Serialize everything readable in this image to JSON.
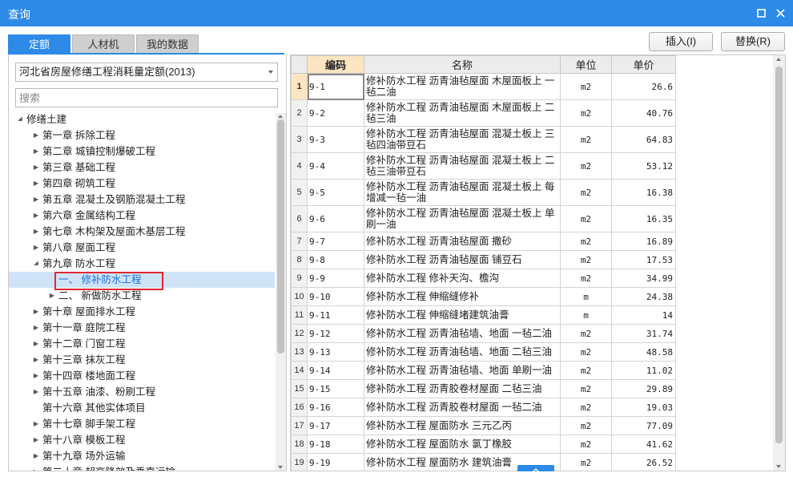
{
  "window": {
    "title": "查询"
  },
  "tabs": [
    {
      "label": "定额",
      "active": true
    },
    {
      "label": "人材机",
      "active": false
    },
    {
      "label": "我的数据",
      "active": false
    }
  ],
  "actions": {
    "insert_label": "插入(I)",
    "replace_label": "替换(R)"
  },
  "left": {
    "library_select": "河北省房屋修缮工程消耗量定额(2013)",
    "search_placeholder": "搜索",
    "tree": [
      {
        "label": "修缮土建",
        "level": 0,
        "state": "expanded"
      },
      {
        "label": "第一章 拆除工程",
        "level": 1,
        "state": "collapsed"
      },
      {
        "label": "第二章 城镇控制爆破工程",
        "level": 1,
        "state": "collapsed"
      },
      {
        "label": "第三章 基础工程",
        "level": 1,
        "state": "collapsed"
      },
      {
        "label": "第四章 砌筑工程",
        "level": 1,
        "state": "collapsed"
      },
      {
        "label": "第五章 混凝土及钢筋混凝土工程",
        "level": 1,
        "state": "collapsed"
      },
      {
        "label": "第六章 金属结构工程",
        "level": 1,
        "state": "collapsed"
      },
      {
        "label": "第七章 木构架及屋面木基层工程",
        "level": 1,
        "state": "collapsed"
      },
      {
        "label": "第八章 屋面工程",
        "level": 1,
        "state": "collapsed"
      },
      {
        "label": "第九章 防水工程",
        "level": 1,
        "state": "expanded"
      },
      {
        "label": "一、 修补防水工程",
        "level": 2,
        "state": "leaf",
        "selected": true
      },
      {
        "label": "二、 新做防水工程",
        "level": 2,
        "state": "collapsed"
      },
      {
        "label": "第十章 屋面排水工程",
        "level": 1,
        "state": "collapsed"
      },
      {
        "label": "第十一章 庭院工程",
        "level": 1,
        "state": "collapsed"
      },
      {
        "label": "第十二章 门窗工程",
        "level": 1,
        "state": "collapsed"
      },
      {
        "label": "第十三章 抹灰工程",
        "level": 1,
        "state": "collapsed"
      },
      {
        "label": "第十四章 楼地面工程",
        "level": 1,
        "state": "collapsed"
      },
      {
        "label": "第十五章 油漆、粉刷工程",
        "level": 1,
        "state": "collapsed"
      },
      {
        "label": "第十六章 其他实体项目",
        "level": 1,
        "state": "leaf"
      },
      {
        "label": "第十七章 脚手架工程",
        "level": 1,
        "state": "collapsed"
      },
      {
        "label": "第十八章 模板工程",
        "level": 1,
        "state": "collapsed"
      },
      {
        "label": "第十九章 场外运输",
        "level": 1,
        "state": "collapsed"
      },
      {
        "label": "第二十章 超高降效及垂直运输",
        "level": 1,
        "state": "collapsed"
      }
    ]
  },
  "grid": {
    "columns": {
      "code": "编码",
      "name": "名称",
      "unit": "单位",
      "price": "单价"
    },
    "rows": [
      {
        "n": "1",
        "code": "9-1",
        "name": "修补防水工程 沥青油毡屋面 木屋面板上 一毡二油",
        "unit": "m2",
        "price": "26.6"
      },
      {
        "n": "2",
        "code": "9-2",
        "name": "修补防水工程 沥青油毡屋面 木屋面板上 二毡三油",
        "unit": "m2",
        "price": "40.76"
      },
      {
        "n": "3",
        "code": "9-3",
        "name": "修补防水工程 沥青油毡屋面 混凝土板上 三毡四油带豆石",
        "unit": "m2",
        "price": "64.83"
      },
      {
        "n": "4",
        "code": "9-4",
        "name": "修补防水工程 沥青油毡屋面 混凝土板上 二毡三油带豆石",
        "unit": "m2",
        "price": "53.12"
      },
      {
        "n": "5",
        "code": "9-5",
        "name": "修补防水工程 沥青油毡屋面 混凝土板上 每增减一毡一油",
        "unit": "m2",
        "price": "16.38"
      },
      {
        "n": "6",
        "code": "9-6",
        "name": "修补防水工程 沥青油毡屋面 混凝土板上 单刷一油",
        "unit": "m2",
        "price": "16.35"
      },
      {
        "n": "7",
        "code": "9-7",
        "name": "修补防水工程 沥青油毡屋面 撒砂",
        "unit": "m2",
        "price": "16.89"
      },
      {
        "n": "8",
        "code": "9-8",
        "name": "修补防水工程 沥青油毡屋面 铺豆石",
        "unit": "m2",
        "price": "17.53"
      },
      {
        "n": "9",
        "code": "9-9",
        "name": "修补防水工程 修补天沟、檐沟",
        "unit": "m2",
        "price": "34.99"
      },
      {
        "n": "10",
        "code": "9-10",
        "name": "修补防水工程 伸缩缝修补",
        "unit": "m",
        "price": "24.38"
      },
      {
        "n": "11",
        "code": "9-11",
        "name": "修补防水工程 伸缩缝堵建筑油膏",
        "unit": "m",
        "price": "14"
      },
      {
        "n": "12",
        "code": "9-12",
        "name": "修补防水工程 沥青油毡墙、地面 一毡二油",
        "unit": "m2",
        "price": "31.74"
      },
      {
        "n": "13",
        "code": "9-13",
        "name": "修补防水工程 沥青油毡墙、地面 二毡三油",
        "unit": "m2",
        "price": "48.58"
      },
      {
        "n": "14",
        "code": "9-14",
        "name": "修补防水工程 沥青油毡墙、地面 单刷一油",
        "unit": "m2",
        "price": "11.02"
      },
      {
        "n": "15",
        "code": "9-15",
        "name": "修补防水工程 沥青胶卷材屋面 二毡三油",
        "unit": "m2",
        "price": "29.89"
      },
      {
        "n": "16",
        "code": "9-16",
        "name": "修补防水工程 沥青胶卷材屋面 一毡二油",
        "unit": "m2",
        "price": "19.03"
      },
      {
        "n": "17",
        "code": "9-17",
        "name": "修补防水工程 屋面防水 三元乙丙",
        "unit": "m2",
        "price": "77.09"
      },
      {
        "n": "18",
        "code": "9-18",
        "name": "修补防水工程 屋面防水 氯丁橡胶",
        "unit": "m2",
        "price": "41.62"
      },
      {
        "n": "19",
        "code": "9-19",
        "name": "修补防水工程 屋面防水 建筑油膏",
        "unit": "m2",
        "price": "26.52"
      }
    ]
  },
  "colors": {
    "accent": "#2d8ae6",
    "highlight_box": "#e0262f",
    "header_active": "#fce5c0",
    "tree_selected": "#cfe3f7"
  }
}
